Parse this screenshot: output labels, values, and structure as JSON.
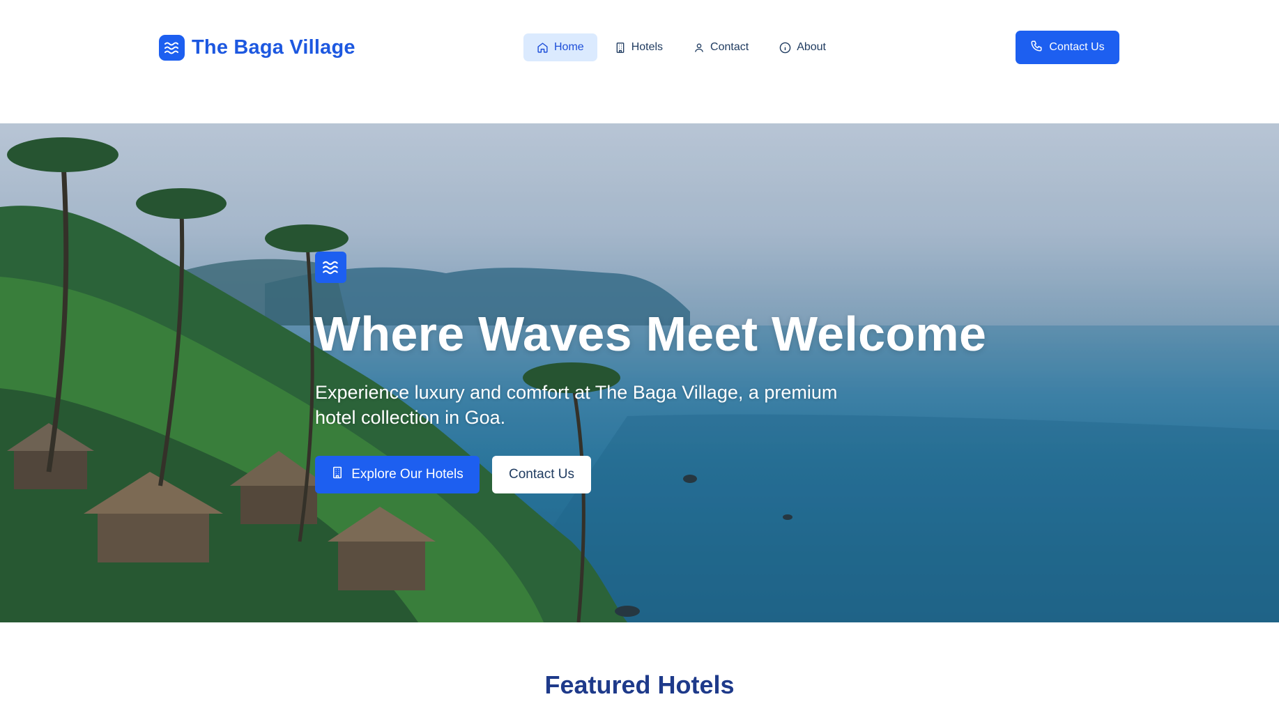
{
  "brand": {
    "name": "The Baga Village",
    "icon": "waves-icon",
    "color": "#1d5ff0"
  },
  "nav": {
    "items": [
      {
        "label": "Home",
        "icon": "home-icon",
        "active": true
      },
      {
        "label": "Hotels",
        "icon": "building-icon",
        "active": false
      },
      {
        "label": "Contact",
        "icon": "user-icon",
        "active": false
      },
      {
        "label": "About",
        "icon": "info-icon",
        "active": false
      }
    ],
    "cta_label": "Contact Us",
    "cta_icon": "phone-icon"
  },
  "hero": {
    "badge_icon": "waves-icon",
    "title": "Where Waves Meet Welcome",
    "subtitle": "Experience luxury and comfort at The Baga Village, a premium hotel collection in Goa.",
    "primary_button": "Explore Our Hotels",
    "primary_icon": "building-icon",
    "secondary_button": "Contact Us"
  },
  "featured": {
    "title": "Featured Hotels"
  },
  "colors": {
    "accent": "#1d5ff0",
    "heading": "#1e3a8a",
    "nav_active_bg": "#dbeafe"
  }
}
